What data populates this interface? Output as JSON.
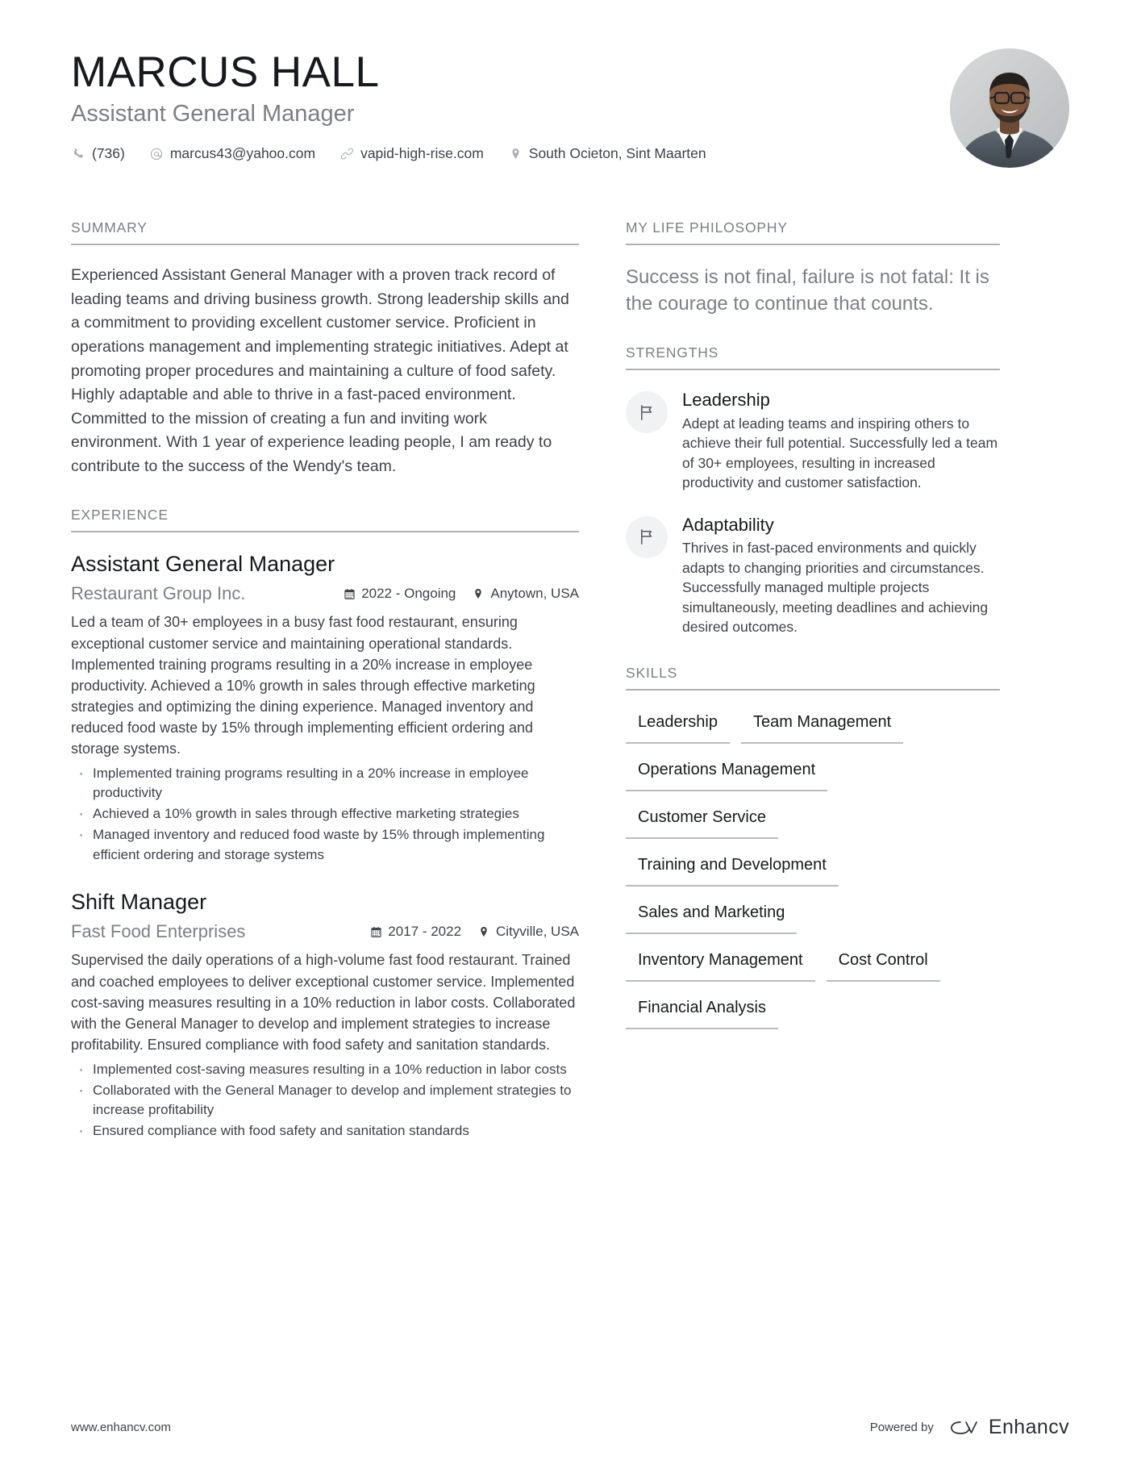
{
  "header": {
    "name": "MARCUS HALL",
    "job_title": "Assistant General Manager",
    "contacts": [
      {
        "icon": "phone-icon",
        "text": "(736)"
      },
      {
        "icon": "email-icon",
        "text": "marcus43@yahoo.com"
      },
      {
        "icon": "link-icon",
        "text": "vapid-high-rise.com"
      },
      {
        "icon": "location-pin-icon",
        "text": "South Ocieton, Sint Maarten"
      }
    ],
    "avatar_alt": "profile-photo"
  },
  "left": {
    "summary": {
      "title": "SUMMARY",
      "text": "Experienced Assistant General Manager with a proven track record of leading teams and driving business growth. Strong leadership skills and a commitment to providing excellent customer service. Proficient in operations management and implementing strategic initiatives. Adept at promoting proper procedures and maintaining a culture of food safety. Highly adaptable and able to thrive in a fast-paced environment. Committed to the mission of creating a fun and inviting work environment. With 1 year of experience leading people, I am ready to contribute to the success of the Wendy's team."
    },
    "experience": {
      "title": "EXPERIENCE",
      "items": [
        {
          "role": "Assistant General Manager",
          "company": "Restaurant Group Inc.",
          "date": "2022 - Ongoing",
          "location": "Anytown, USA",
          "description": "Led a team of 30+ employees in a busy fast food restaurant, ensuring exceptional customer service and maintaining operational standards. Implemented training programs resulting in a 20% increase in employee productivity. Achieved a 10% growth in sales through effective marketing strategies and optimizing the dining experience. Managed inventory and reduced food waste by 15% through implementing efficient ordering and storage systems.",
          "bullets": [
            "Implemented training programs resulting in a 20% increase in employee productivity",
            "Achieved a 10% growth in sales through effective marketing strategies",
            "Managed inventory and reduced food waste by 15% through implementing efficient ordering and storage systems"
          ]
        },
        {
          "role": "Shift Manager",
          "company": "Fast Food Enterprises",
          "date": "2017 - 2022",
          "location": "Cityville, USA",
          "description": "Supervised the daily operations of a high-volume fast food restaurant. Trained and coached employees to deliver exceptional customer service. Implemented cost-saving measures resulting in a 10% reduction in labor costs. Collaborated with the General Manager to develop and implement strategies to increase profitability. Ensured compliance with food safety and sanitation standards.",
          "bullets": [
            "Implemented cost-saving measures resulting in a 10% reduction in labor costs",
            "Collaborated with the General Manager to develop and implement strategies to increase profitability",
            "Ensured compliance with food safety and sanitation standards"
          ]
        }
      ]
    }
  },
  "right": {
    "philosophy": {
      "title": "MY LIFE PHILOSOPHY",
      "quote": "Success is not final, failure is not fatal: It is the courage to continue that counts."
    },
    "strengths": {
      "title": "STRENGTHS",
      "items": [
        {
          "icon": "flag-icon",
          "name": "Leadership",
          "description": "Adept at leading teams and inspiring others to achieve their full potential. Successfully led a team of 30+ employees, resulting in increased productivity and customer satisfaction."
        },
        {
          "icon": "flag-icon",
          "name": "Adaptability",
          "description": "Thrives in fast-paced environments and quickly adapts to changing priorities and circumstances. Successfully managed multiple projects simultaneously, meeting deadlines and achieving desired outcomes."
        }
      ]
    },
    "skills": {
      "title": "SKILLS",
      "items": [
        "Leadership",
        "Team Management",
        "Operations Management",
        "Customer Service",
        "Training and Development",
        "Sales and Marketing",
        "Inventory Management",
        "Cost Control",
        "Financial Analysis"
      ]
    }
  },
  "footer": {
    "url": "www.enhancv.com",
    "powered_by": "Powered by",
    "brand": "Enhancv"
  },
  "colors": {
    "text_primary": "#16191d",
    "text_body": "#3d434a",
    "text_muted": "#7b8086",
    "rule": "#aeb2b6",
    "chip_underline": "#b9bdc1",
    "icon_bg": "#f1f2f3"
  }
}
